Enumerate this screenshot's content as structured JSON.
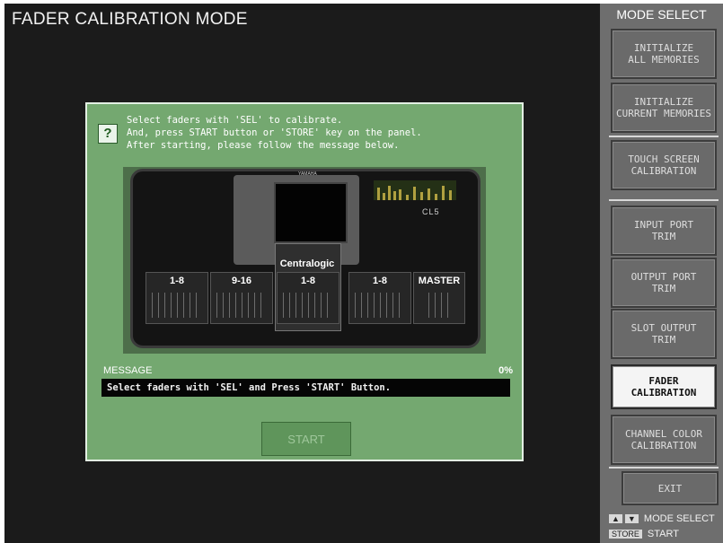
{
  "header": {
    "title": "FADER CALIBRATION MODE"
  },
  "mode_select": {
    "title": "MODE SELECT",
    "buttons": [
      {
        "label": "INITIALIZE\nALL MEMORIES",
        "active": false
      },
      {
        "label": "INITIALIZE\nCURRENT MEMORIES",
        "active": false
      },
      {
        "label": "TOUCH SCREEN\nCALIBRATION",
        "active": false
      },
      {
        "label": "INPUT PORT\nTRIM",
        "active": false
      },
      {
        "label": "OUTPUT PORT\nTRIM",
        "active": false
      },
      {
        "label": "SLOT OUTPUT\nTRIM",
        "active": false
      },
      {
        "label": "FADER\nCALIBRATION",
        "active": true
      },
      {
        "label": "CHANNEL COLOR\nCALIBRATION",
        "active": false
      }
    ],
    "exit_label": "EXIT",
    "legend": {
      "arrows_text": "MODE SELECT",
      "store_key": "STORE",
      "store_text": "START"
    }
  },
  "dialog": {
    "help_icon": "?",
    "instructions": [
      "Select faders with 'SEL' to calibrate.",
      "And, press START button or 'STORE' key on the panel.",
      "After starting, please follow the message below."
    ],
    "console": {
      "brand": "YAMAHA",
      "model": "CL5",
      "centralogic_label": "Centralogic",
      "banks": [
        "1-8",
        "9-16",
        "1-8",
        "1-8",
        "MASTER"
      ]
    },
    "message_label": "MESSAGE",
    "progress_text": "0%",
    "progress": 0,
    "message_text": "Select faders with 'SEL' and Press 'START' Button.",
    "start_label": "START"
  }
}
